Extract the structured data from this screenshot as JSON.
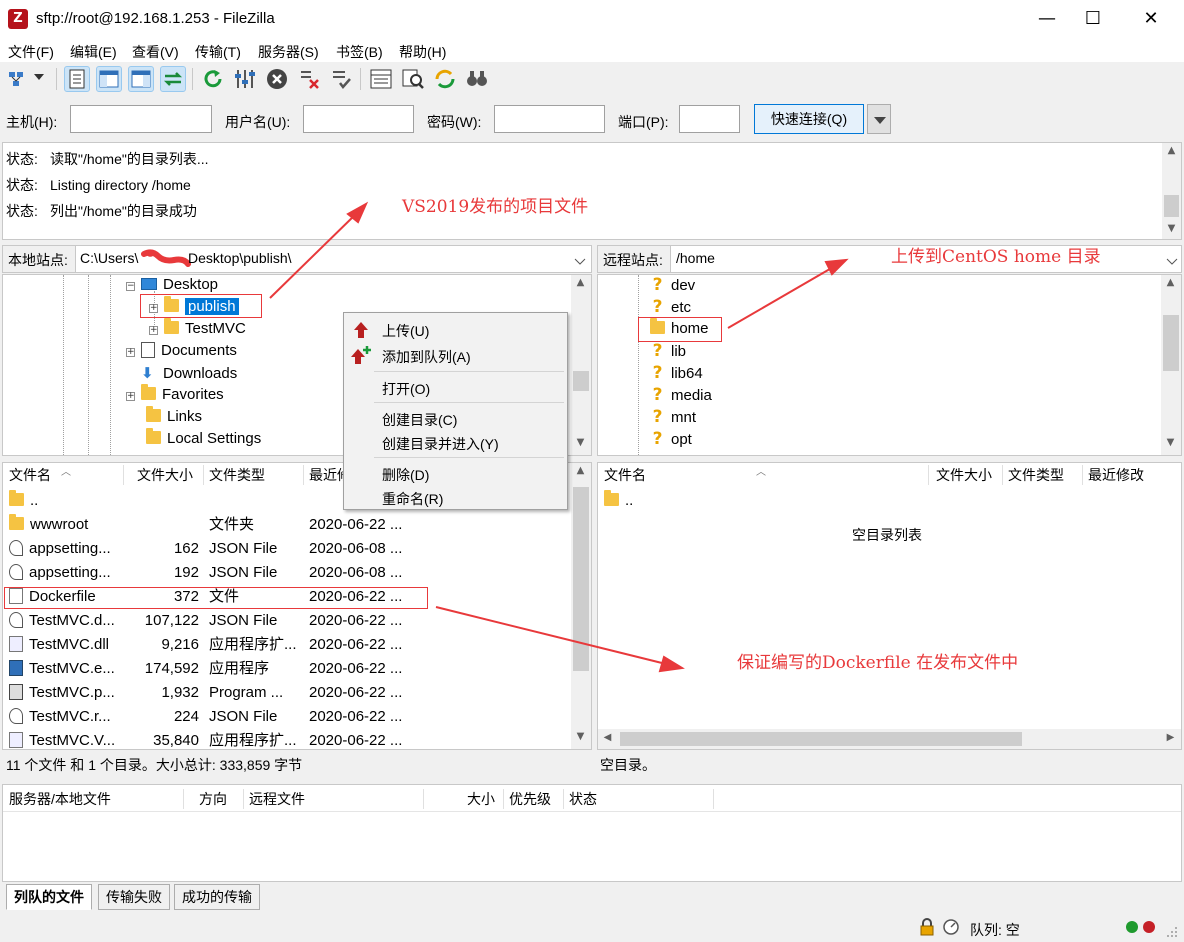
{
  "window": {
    "title": "sftp://root@192.168.1.253 - FileZilla",
    "app_icon": "Z",
    "minimize": "—",
    "maximize": "☐",
    "close": "✕"
  },
  "menu": [
    "文件(F)",
    "编辑(E)",
    "查看(V)",
    "传输(T)",
    "服务器(S)",
    "书签(B)",
    "帮助(H)"
  ],
  "quickconnect": {
    "host_label": "主机(H):",
    "user_label": "用户名(U):",
    "pass_label": "密码(W):",
    "port_label": "端口(P):",
    "host_value": "",
    "user_value": "",
    "pass_value": "",
    "port_value": "",
    "connect_button": "快速连接(Q)"
  },
  "log": [
    {
      "prefix": "状态:",
      "text": "读取\"/home\"的目录列表..."
    },
    {
      "prefix": "状态:",
      "text": "Listing directory /home"
    },
    {
      "prefix": "状态:",
      "text": "列出\"/home\"的目录成功"
    }
  ],
  "local": {
    "site_label": "本地站点:",
    "path_left": "C:\\Users\\",
    "path_right": "Desktop\\publish\\",
    "tree": [
      {
        "label": "Desktop",
        "kind": "desktop",
        "expander": "minus"
      },
      {
        "label": "publish",
        "kind": "folder",
        "expander": "plus",
        "selected": true
      },
      {
        "label": "TestMVC",
        "kind": "folder",
        "expander": "plus"
      },
      {
        "label": "Documents",
        "kind": "docs",
        "expander": "plus"
      },
      {
        "label": "Downloads",
        "kind": "download",
        "expander": "none"
      },
      {
        "label": "Favorites",
        "kind": "folder",
        "expander": "plus"
      },
      {
        "label": "Links",
        "kind": "folder",
        "expander": "none"
      },
      {
        "label": "Local Settings",
        "kind": "folder",
        "expander": "none"
      }
    ],
    "columns": [
      "文件名",
      "文件大小",
      "文件类型",
      "最近修"
    ],
    "files": [
      {
        "name": "..",
        "size": "",
        "type": "",
        "date": "",
        "icon": "folder"
      },
      {
        "name": "wwwroot",
        "size": "",
        "type": "文件夹",
        "date": "2020-06-22 ...",
        "icon": "folder"
      },
      {
        "name": "appsetting...",
        "size": "162",
        "type": "JSON File",
        "date": "2020-06-08 ...",
        "icon": "json"
      },
      {
        "name": "appsetting...",
        "size": "192",
        "type": "JSON File",
        "date": "2020-06-08 ...",
        "icon": "json"
      },
      {
        "name": "Dockerfile",
        "size": "372",
        "type": "文件",
        "date": "2020-06-22 ...",
        "icon": "doc"
      },
      {
        "name": "TestMVC.d...",
        "size": "107,122",
        "type": "JSON File",
        "date": "2020-06-22 ...",
        "icon": "json"
      },
      {
        "name": "TestMVC.dll",
        "size": "9,216",
        "type": "应用程序扩...",
        "date": "2020-06-22 ...",
        "icon": "dll"
      },
      {
        "name": "TestMVC.e...",
        "size": "174,592",
        "type": "应用程序",
        "date": "2020-06-22 ...",
        "icon": "exe"
      },
      {
        "name": "TestMVC.p...",
        "size": "1,932",
        "type": "Program ...",
        "date": "2020-06-22 ...",
        "icon": "prog"
      },
      {
        "name": "TestMVC.r...",
        "size": "224",
        "type": "JSON File",
        "date": "2020-06-22 ...",
        "icon": "json"
      },
      {
        "name": "TestMVC.V...",
        "size": "35,840",
        "type": "应用程序扩...",
        "date": "2020-06-22 ...",
        "icon": "dll"
      }
    ],
    "status": "11 个文件 和 1 个目录。大小总计: 333,859 字节"
  },
  "remote": {
    "site_label": "远程站点:",
    "path": "/home",
    "tree": [
      {
        "label": "dev",
        "kind": "unknown"
      },
      {
        "label": "etc",
        "kind": "unknown"
      },
      {
        "label": "home",
        "kind": "folder"
      },
      {
        "label": "lib",
        "kind": "unknown"
      },
      {
        "label": "lib64",
        "kind": "unknown"
      },
      {
        "label": "media",
        "kind": "unknown"
      },
      {
        "label": "mnt",
        "kind": "unknown"
      },
      {
        "label": "opt",
        "kind": "unknown"
      }
    ],
    "columns": [
      "文件名",
      "文件大小",
      "文件类型",
      "最近修改"
    ],
    "files": [
      {
        "name": "..",
        "icon": "folder"
      }
    ],
    "empty_text": "空目录列表",
    "status": "空目录。"
  },
  "context_menu": {
    "upload": "上传(U)",
    "add_queue": "添加到队列(A)",
    "open": "打开(O)",
    "mkdir": "创建目录(C)",
    "mkdir_enter": "创建目录并进入(Y)",
    "delete": "删除(D)",
    "rename": "重命名(R)"
  },
  "queue": {
    "columns": [
      "服务器/本地文件",
      "方向",
      "远程文件",
      "大小",
      "优先级",
      "状态"
    ],
    "tabs": [
      "列队的文件",
      "传输失败",
      "成功的传输"
    ],
    "status": "队列: 空"
  },
  "annotations": {
    "publish_note": "VS2019发布的项目文件",
    "home_note": "上传到CentOS home 目录",
    "dockerfile_note": "保证编写的Dockerfile 在发布文件中",
    "color": "#e8393b"
  },
  "colors": {
    "selection": "#0078d7",
    "accent_button": "#e5f1fb",
    "annotation": "#e8393b"
  }
}
